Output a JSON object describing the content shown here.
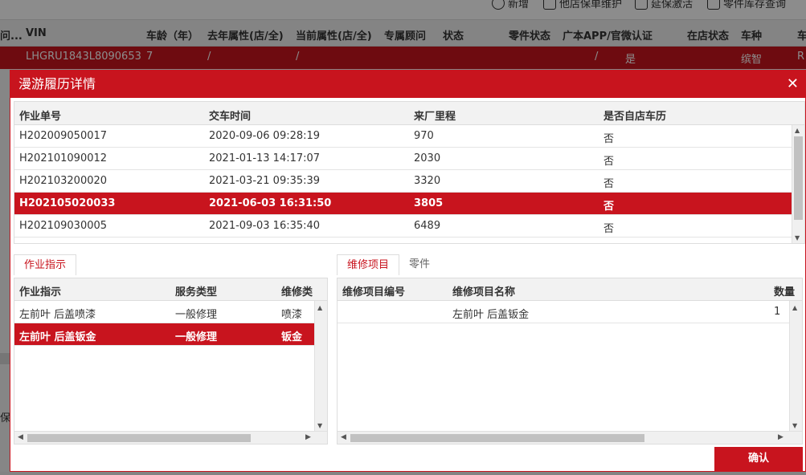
{
  "background": {
    "toolbar": [
      {
        "label": "新增",
        "icon": "plus-circle-icon"
      },
      {
        "label": "他店保单维护",
        "icon": "document-icon"
      },
      {
        "label": "延保激活",
        "icon": "edit-icon"
      },
      {
        "label": "零件库存查询",
        "icon": "warehouse-icon"
      }
    ],
    "header": [
      "问...",
      "VIN",
      "车龄（年）",
      "去年属性(店/全)",
      "当前属性(店/全)",
      "专属顾问",
      "状态",
      "零件状态",
      "广本APP/官微认证",
      "在店状态",
      "车种",
      "车"
    ],
    "row": [
      "LHGRU1843L8090653",
      "7",
      "/",
      "/",
      "/",
      "是",
      "缤智",
      "R"
    ],
    "side_text": "保"
  },
  "modal": {
    "title": "漫游履历详情",
    "close_icon": "close-icon",
    "history_table": {
      "columns": [
        "作业单号",
        "交车时间",
        "来厂里程",
        "是否自店车历"
      ],
      "rows": [
        {
          "order": "H202009050017",
          "time": "2020-09-06 09:28:19",
          "mileage": "970",
          "own": "否",
          "selected": false
        },
        {
          "order": "H202101090012",
          "time": "2021-01-13 14:17:07",
          "mileage": "2030",
          "own": "否",
          "selected": false
        },
        {
          "order": "H202103200020",
          "time": "2021-03-21 09:35:39",
          "mileage": "3320",
          "own": "否",
          "selected": false
        },
        {
          "order": "H202105020033",
          "time": "2021-06-03 16:31:50",
          "mileage": "3805",
          "own": "否",
          "selected": true
        },
        {
          "order": "H202109030005",
          "time": "2021-09-03 16:35:40",
          "mileage": "6489",
          "own": "否",
          "selected": false
        }
      ]
    },
    "left_panel": {
      "tabs": [
        {
          "label": "作业指示",
          "active": true
        }
      ],
      "columns": [
        "作业指示",
        "服务类型",
        "维修类"
      ],
      "rows": [
        {
          "instruction": "左前叶 后盖喷漆",
          "service": "一般修理",
          "repair": "喷漆",
          "selected": false
        },
        {
          "instruction": "左前叶 后盖钣金",
          "service": "一般修理",
          "repair": "钣金",
          "selected": true
        }
      ]
    },
    "right_panel": {
      "tabs": [
        {
          "label": "维修项目",
          "active": true
        },
        {
          "label": "零件",
          "active": false
        }
      ],
      "columns": [
        "维修项目编号",
        "维修项目名称",
        "数量"
      ],
      "rows": [
        {
          "code": "",
          "name": "左前叶 后盖钣金",
          "qty": "1"
        }
      ]
    },
    "confirm_label": "确认"
  },
  "colors": {
    "accent": "#c8141e",
    "header_bg": "#f2f2f2"
  }
}
